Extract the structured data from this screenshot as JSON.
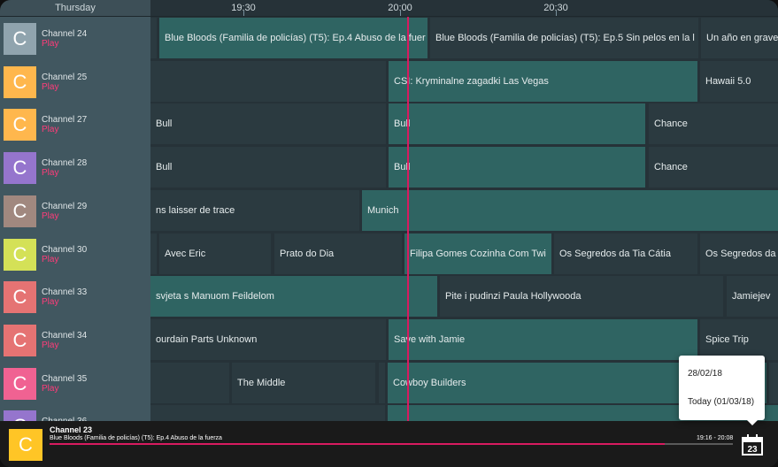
{
  "header": {
    "day": "Thursday",
    "times": [
      "19:30",
      "20:00",
      "20:30"
    ]
  },
  "channels": [
    {
      "letter": "C",
      "name": "Channel 24",
      "play": "Play",
      "color": "#90a4ae"
    },
    {
      "letter": "C",
      "name": "Channel 25",
      "play": "Play",
      "color": "#ffb74d"
    },
    {
      "letter": "C",
      "name": "Channel 27",
      "play": "Play",
      "color": "#ffb74d"
    },
    {
      "letter": "C",
      "name": "Channel 28",
      "play": "Play",
      "color": "#9575cd"
    },
    {
      "letter": "C",
      "name": "Channel 29",
      "play": "Play",
      "color": "#a1887f"
    },
    {
      "letter": "C",
      "name": "Channel 30",
      "play": "Play",
      "color": "#d4e157"
    },
    {
      "letter": "C",
      "name": "Channel 33",
      "play": "Play",
      "color": "#e57373"
    },
    {
      "letter": "C",
      "name": "Channel 34",
      "play": "Play",
      "color": "#e57373"
    },
    {
      "letter": "C",
      "name": "Channel 35",
      "play": "Play",
      "color": "#f06292"
    },
    {
      "letter": "C",
      "name": "Channel 36",
      "play": "Play",
      "color": "#9575cd"
    }
  ],
  "programs": [
    [
      {
        "title": "",
        "airing": false
      },
      {
        "title": "Blue Bloods (Familia de policías) (T5): Ep.4 Abuso de la fuer",
        "airing": true
      },
      {
        "title": "Blue Bloods (Familia de policías) (T5): Ep.5 Sin pelos en la l",
        "airing": false
      },
      {
        "title": "Un año en grave",
        "airing": false
      }
    ],
    [
      {
        "title": "",
        "airing": false
      },
      {
        "title": "CSI: Kryminalne zagadki Las Vegas",
        "airing": true
      },
      {
        "title": "Hawaii 5.0",
        "airing": false
      }
    ],
    [
      {
        "title": "Bull",
        "airing": false
      },
      {
        "title": "Bull",
        "airing": true
      },
      {
        "title": "Chance",
        "airing": false
      }
    ],
    [
      {
        "title": "Bull",
        "airing": false
      },
      {
        "title": "Bull",
        "airing": true
      },
      {
        "title": "Chance",
        "airing": false
      }
    ],
    [
      {
        "title": "ns laisser de trace",
        "airing": false
      },
      {
        "title": "Munich",
        "airing": true
      }
    ],
    [
      {
        "title": "",
        "airing": false
      },
      {
        "title": "Avec Eric",
        "airing": false
      },
      {
        "title": "Prato do Dia",
        "airing": false
      },
      {
        "title": "Filipa Gomes Cozinha Com Twi",
        "airing": true
      },
      {
        "title": "Os Segredos da Tia Cátia",
        "airing": false
      },
      {
        "title": "Os Segredos da",
        "airing": false
      }
    ],
    [
      {
        "title": "svjeta s Manuom Feildelom",
        "airing": true
      },
      {
        "title": "Pite i pudinzi Paula Hollywooda",
        "airing": false
      },
      {
        "title": "Jamiejev",
        "airing": false
      }
    ],
    [
      {
        "title": "ourdain Parts Unknown",
        "airing": false
      },
      {
        "title": "Save with Jamie",
        "airing": true
      },
      {
        "title": "Spice Trip",
        "airing": false
      }
    ],
    [
      {
        "title": "",
        "airing": false
      },
      {
        "title": "The Middle",
        "airing": false
      },
      {
        "title": "",
        "airing": false
      },
      {
        "title": "Cowboy Builders",
        "airing": true
      },
      {
        "title": "",
        "airing": false
      }
    ],
    [
      {
        "title": "",
        "airing": false
      },
      {
        "title": "",
        "airing": false
      },
      {
        "title": "",
        "airing": true
      }
    ]
  ],
  "now_playing": {
    "letter": "C",
    "channel": "Channel 23",
    "title": "Blue Bloods (Familia de policías) (T5): Ep.4 Abuso de la fuerza",
    "time": "19:16 - 20:08",
    "progress": 0.9,
    "logo_color": "#ffc526"
  },
  "calendar": {
    "day": "23"
  },
  "date_popup": {
    "options": [
      "28/02/18",
      "Today (01/03/18)"
    ]
  },
  "colors": {
    "accent": "#d81b60",
    "airing": "#2f6462",
    "program": "#2b3a40",
    "channel_panel": "#415760"
  }
}
